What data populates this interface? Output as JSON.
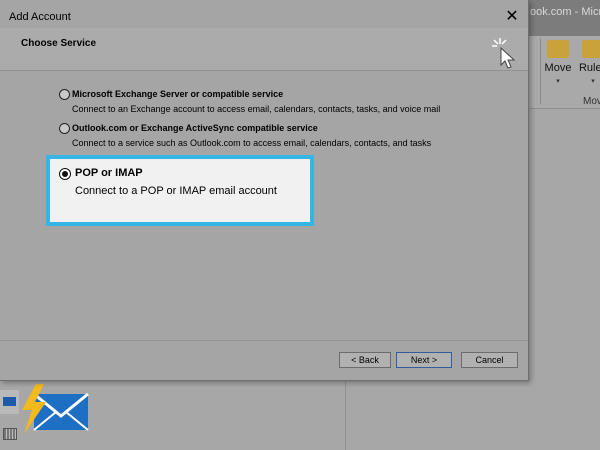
{
  "background_app": {
    "title_fragment": "ook.com - Micros",
    "ribbon": {
      "move_label": "Move",
      "rules_label": "Rules",
      "group_label": "Mov"
    }
  },
  "dialog": {
    "title": "Add Account",
    "heading": "Choose Service",
    "options": [
      {
        "title": "Microsoft Exchange Server or compatible service",
        "description": "Connect to an Exchange account to access email, calendars, contacts, tasks, and voice mail",
        "selected": false
      },
      {
        "title": "Outlook.com or Exchange ActiveSync compatible service",
        "description": "Connect to a service such as Outlook.com to access email, calendars, contacts, and tasks",
        "selected": false
      },
      {
        "title": "POP or IMAP",
        "description": "Connect to a POP or IMAP email account",
        "selected": true
      }
    ],
    "buttons": {
      "back": "< Back",
      "next": "Next >",
      "cancel": "Cancel"
    },
    "close_glyph": "✕"
  },
  "colors": {
    "highlight_border": "#35b6e7",
    "highlight_fill": "#f1f1f1",
    "overlay": "#a5a5a5"
  },
  "icons": [
    "close-icon",
    "wizard-icon",
    "folder-move-icon",
    "rules-icon",
    "mail-icon",
    "calendar-icon",
    "envelope-lightning-icon"
  ]
}
